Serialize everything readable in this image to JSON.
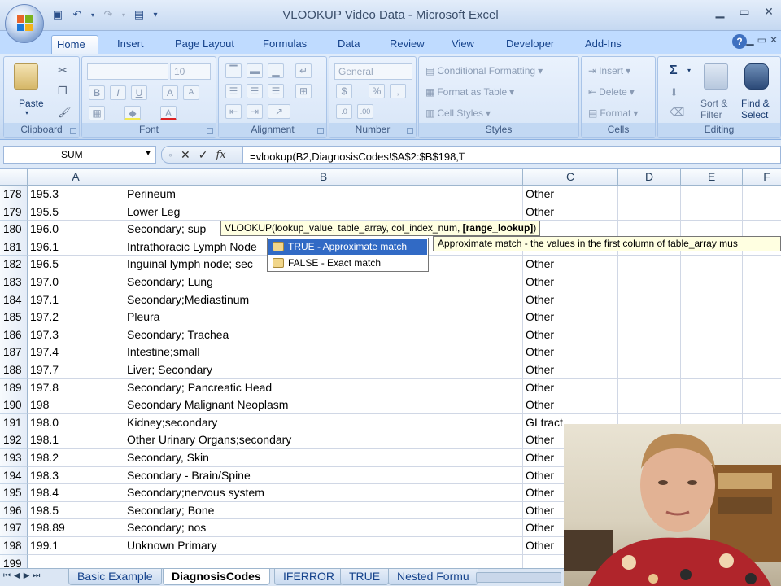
{
  "window": {
    "title": "VLOOKUP Video Data - Microsoft Excel",
    "controls": [
      "minimize-icon",
      "maximize-icon",
      "close-icon"
    ]
  },
  "quick_access": [
    "save-icon",
    "undo-icon",
    "redo-icon",
    "print-preview-icon",
    "customize-icon"
  ],
  "tabs": [
    {
      "label": "Home",
      "active": true
    },
    {
      "label": "Insert"
    },
    {
      "label": "Page Layout"
    },
    {
      "label": "Formulas"
    },
    {
      "label": "Data"
    },
    {
      "label": "Review"
    },
    {
      "label": "View"
    },
    {
      "label": "Developer"
    },
    {
      "label": "Add-Ins"
    }
  ],
  "ribbon": {
    "clipboard": {
      "label": "Clipboard",
      "paste": "Paste"
    },
    "font": {
      "label": "Font",
      "size": "10",
      "bold": "B",
      "italic": "I",
      "underline": "U",
      "grow": "A",
      "shrink": "A"
    },
    "alignment": {
      "label": "Alignment"
    },
    "number": {
      "label": "Number",
      "format": "General",
      "currency": "$",
      "percent": "%",
      "comma": ","
    },
    "styles": {
      "label": "Styles",
      "conditional": "Conditional Formatting",
      "format_table": "Format as Table",
      "cell_styles": "Cell Styles"
    },
    "cells": {
      "label": "Cells",
      "insert": "Insert",
      "delete": "Delete",
      "format": "Format"
    },
    "editing": {
      "label": "Editing",
      "sigma": "Σ",
      "sort": "Sort &",
      "filter": "Filter",
      "find": "Find &",
      "select": "Select"
    }
  },
  "formula_bar": {
    "name_box": "SUM",
    "cancel": "✕",
    "enter": "✓",
    "fx": "fx",
    "formula": "=vlookup(B2,DiagnosisCodes!$A$2:$B$198,"
  },
  "columns": [
    "A",
    "B",
    "C",
    "D",
    "E",
    "F"
  ],
  "rows": [
    {
      "num": "178",
      "a": "195.3",
      "b": "Perineum",
      "c": "Other"
    },
    {
      "num": "179",
      "a": "195.5",
      "b": "Lower Leg",
      "c": "Other"
    },
    {
      "num": "180",
      "a": "196.0",
      "b": "Secondary; sup",
      "c": ""
    },
    {
      "num": "181",
      "a": "196.1",
      "b": "Intrathoracic Lymph Node",
      "c": ""
    },
    {
      "num": "182",
      "a": "196.5",
      "b": "Inguinal lymph node; sec",
      "c": "Other"
    },
    {
      "num": "183",
      "a": "197.0",
      "b": "Secondary; Lung",
      "c": "Other"
    },
    {
      "num": "184",
      "a": "197.1",
      "b": "Secondary;Mediastinum",
      "c": "Other"
    },
    {
      "num": "185",
      "a": "197.2",
      "b": "Pleura",
      "c": "Other"
    },
    {
      "num": "186",
      "a": "197.3",
      "b": "Secondary; Trachea",
      "c": "Other"
    },
    {
      "num": "187",
      "a": "197.4",
      "b": "Intestine;small",
      "c": "Other"
    },
    {
      "num": "188",
      "a": "197.7",
      "b": "Liver; Secondary",
      "c": "Other"
    },
    {
      "num": "189",
      "a": "197.8",
      "b": "Secondary; Pancreatic Head",
      "c": "Other"
    },
    {
      "num": "190",
      "a": "198",
      "b": "Secondary Malignant Neoplasm",
      "c": "Other"
    },
    {
      "num": "191",
      "a": "198.0",
      "b": "Kidney;secondary",
      "c": "GI tract"
    },
    {
      "num": "192",
      "a": "198.1",
      "b": "Other Urinary Organs;secondary",
      "c": "Other"
    },
    {
      "num": "193",
      "a": "198.2",
      "b": "Secondary, Skin",
      "c": "Other"
    },
    {
      "num": "194",
      "a": "198.3",
      "b": "Secondary - Brain/Spine",
      "c": "Other"
    },
    {
      "num": "195",
      "a": "198.4",
      "b": "Secondary;nervous system",
      "c": "Other"
    },
    {
      "num": "196",
      "a": "198.5",
      "b": "Secondary; Bone",
      "c": "Other"
    },
    {
      "num": "197",
      "a": "198.89",
      "b": "Secondary; nos",
      "c": "Other"
    },
    {
      "num": "198",
      "a": "199.1",
      "b": "Unknown Primary",
      "c": "Other"
    },
    {
      "num": "199",
      "a": "",
      "b": "",
      "c": ""
    }
  ],
  "tooltip": {
    "signature_start": "VLOOKUP(lookup_value, table_array, col_index_num, ",
    "signature_bold": "[range_lookup]",
    "signature_end": ")"
  },
  "autocomplete": {
    "items": [
      "TRUE - Approximate match",
      "FALSE - Exact match"
    ],
    "description": "Approximate match - the values in the first column of table_array mus"
  },
  "sheets": [
    {
      "label": "Basic Example"
    },
    {
      "label": "DiagnosisCodes",
      "active": true
    },
    {
      "label": "IFERROR"
    },
    {
      "label": "TRUE"
    },
    {
      "label": "Nested Formu"
    }
  ]
}
